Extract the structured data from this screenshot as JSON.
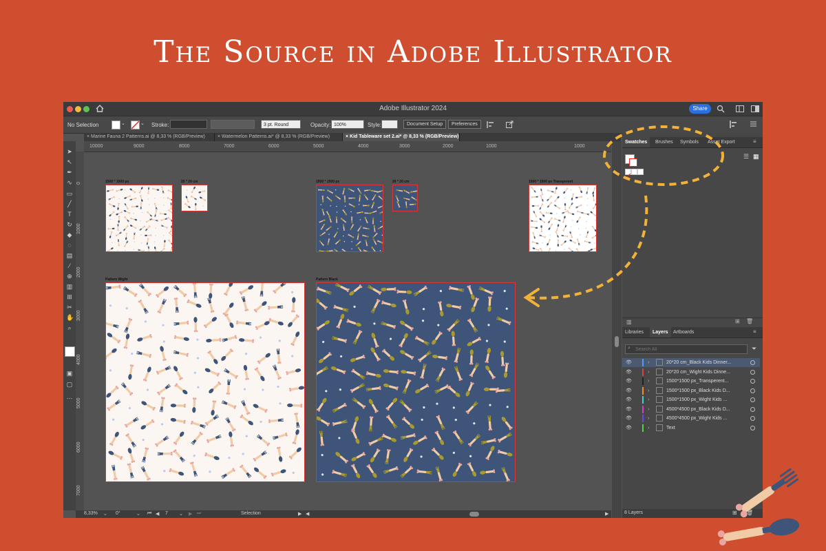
{
  "promo": {
    "title": "The Source in Adobe Illustrator"
  },
  "colors": {
    "background": "#cf4e30",
    "accent_dash": "#f2b23a",
    "pattern_navy": "#3e5478",
    "pattern_white": "#fbf6f2"
  },
  "window": {
    "title": "Adobe Illustrator 2024",
    "share_label": "Share"
  },
  "control_bar": {
    "selection": "No Selection",
    "stroke_label": "Stroke:",
    "brush": "3 pt. Round",
    "opacity_label": "Opacity:",
    "opacity_value": "100%",
    "style_label": "Style:",
    "document_setup": "Document Setup",
    "preferences": "Preferences"
  },
  "doc_tabs": [
    {
      "label": "Marine Fauna 2 Patterns.ai @ 8,33 % (RGB/Preview)"
    },
    {
      "label": "Watermelon Patterns.ai* @ 8,33 % (RGB/Preview)"
    },
    {
      "label": "Kid Tableware set 2.ai* @ 8,33 % (RGB/Preview)"
    }
  ],
  "ruler_h": [
    "10000",
    "9000",
    "8000",
    "7000",
    "6000",
    "5000",
    "4000",
    "3000",
    "2000",
    "1000",
    "1000"
  ],
  "ruler_v": [
    "0",
    "1000",
    "2000",
    "3000",
    "4000",
    "5000",
    "6000",
    "7000"
  ],
  "artboards": [
    {
      "label": "1500 * 1500 px"
    },
    {
      "label": "20 * 20 cm"
    },
    {
      "label": "1500 * 1500 px"
    },
    {
      "label": "20 * 20 cm"
    },
    {
      "label": "1500 * 1500 px Transperent"
    },
    {
      "label": "Pattern Wight"
    },
    {
      "label": "Pattern Black"
    }
  ],
  "swatches_panel": {
    "tabs": [
      "Swatches",
      "Brushes",
      "Symbols",
      "Asset Export"
    ]
  },
  "layers_panel": {
    "tabs": [
      "Libraries",
      "Layers",
      "Artboards"
    ],
    "search_placeholder": "Search All",
    "layers": [
      {
        "name": "20*20 cm_Black Kids Dinner...",
        "color": "#4d9bff"
      },
      {
        "name": "20*20 cm_Wight Kids Dinne...",
        "color": "#e04040"
      },
      {
        "name": "1500*1500 px_Transperent...",
        "color": "#222222"
      },
      {
        "name": "1500*1500 px_Black Kids D...",
        "color": "#f08a2a"
      },
      {
        "name": "1500*1500 px_Wight Kids ...",
        "color": "#3fd0d0"
      },
      {
        "name": "4500*4500 px_Black Kids D...",
        "color": "#d040d0"
      },
      {
        "name": "4500*4500 px_Wight Kids ...",
        "color": "#6a4adc"
      },
      {
        "name": "Text",
        "color": "#5ad04a"
      }
    ],
    "count_label": "8 Layers"
  },
  "status_bar": {
    "zoom": "8,33%",
    "angle": "0°",
    "artboard": "7",
    "tool": "Selection"
  }
}
